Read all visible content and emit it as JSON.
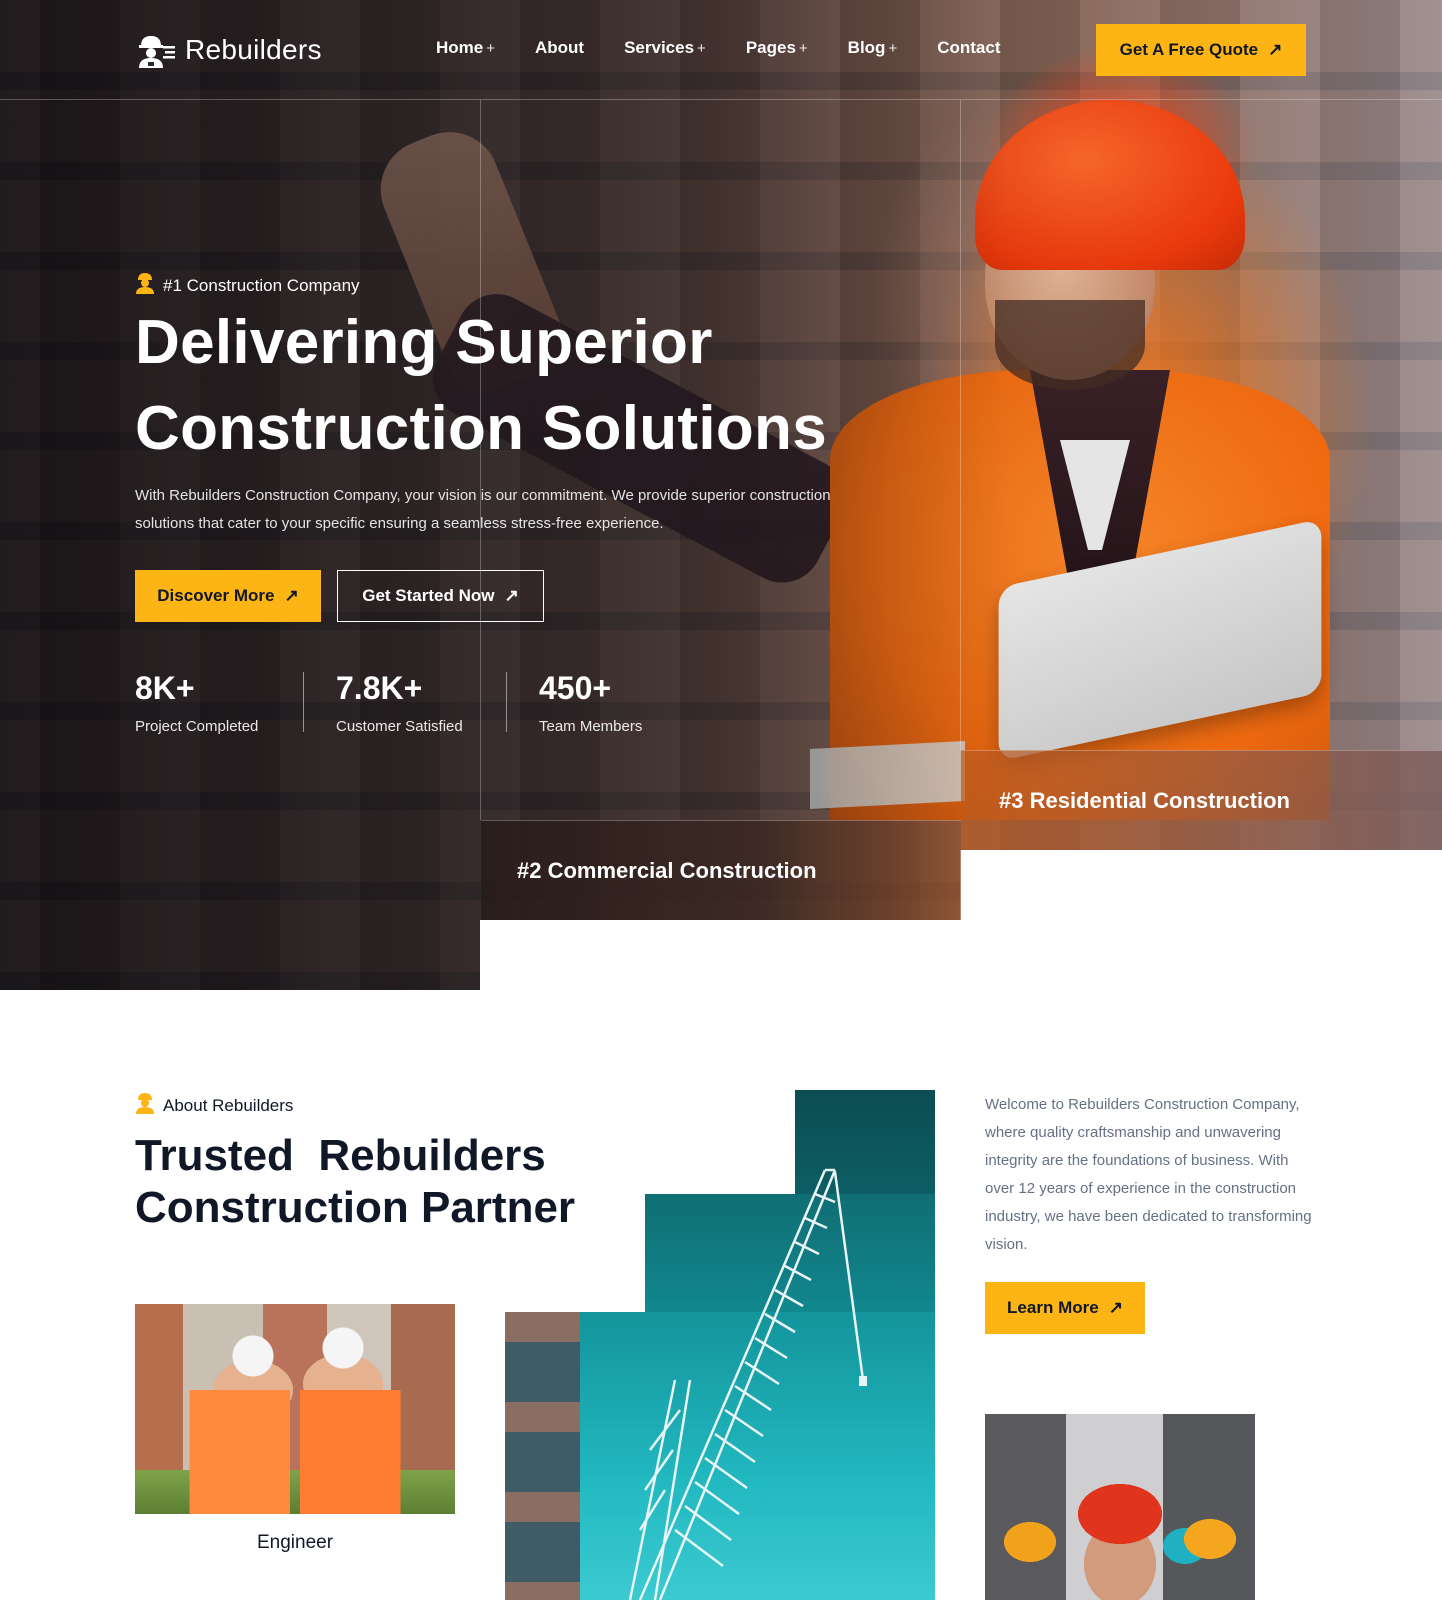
{
  "header": {
    "logo_text": "Rebuilders",
    "nav": [
      {
        "label": "Home",
        "plus": "+"
      },
      {
        "label": "About",
        "plus": ""
      },
      {
        "label": "Services",
        "plus": "+"
      },
      {
        "label": "Pages",
        "plus": "+"
      },
      {
        "label": "Blog",
        "plus": "+"
      },
      {
        "label": "Contact",
        "plus": ""
      }
    ],
    "quote_button": "Get A Free Quote",
    "arrow": "↗"
  },
  "hero": {
    "tagline": "#1 Construction Company",
    "title_line1": "Delivering Superior",
    "title_line2": "Construction Solutions",
    "description": "With Rebuilders Construction Company, your vision is our commitment. We provide superior construction solutions that cater to your specific  ensuring a seamless stress-free experience.",
    "btn_discover": "Discover More",
    "btn_started": "Get Started Now",
    "stats": [
      {
        "value": "8K+",
        "label": "Project Completed"
      },
      {
        "value": "7.8K+",
        "label": "Customer Satisfied"
      },
      {
        "value": "450+",
        "label": "Team Members"
      }
    ],
    "card_2": "#2 Commercial Construction",
    "card_3": "#3 Residential Construction"
  },
  "about": {
    "tag": "About Rebuilders",
    "title": "Trusted  Rebuilders\nConstruction Partner",
    "description": "Welcome to Rebuilders Construction Company, where quality craftsmanship and unwavering integrity are the foundations of business. With over 12 years of experience in the construction industry, we have been dedicated to transforming vision.",
    "learn_button": "Learn More",
    "engineer_label": "Engineer"
  },
  "colors": {
    "accent": "#fdb515",
    "dark": "#101828",
    "muted": "#667085"
  },
  "icons": {
    "logo": "worker-helmet-logo-icon",
    "tag": "worker-icon",
    "arrow": "arrow-up-right-icon"
  }
}
